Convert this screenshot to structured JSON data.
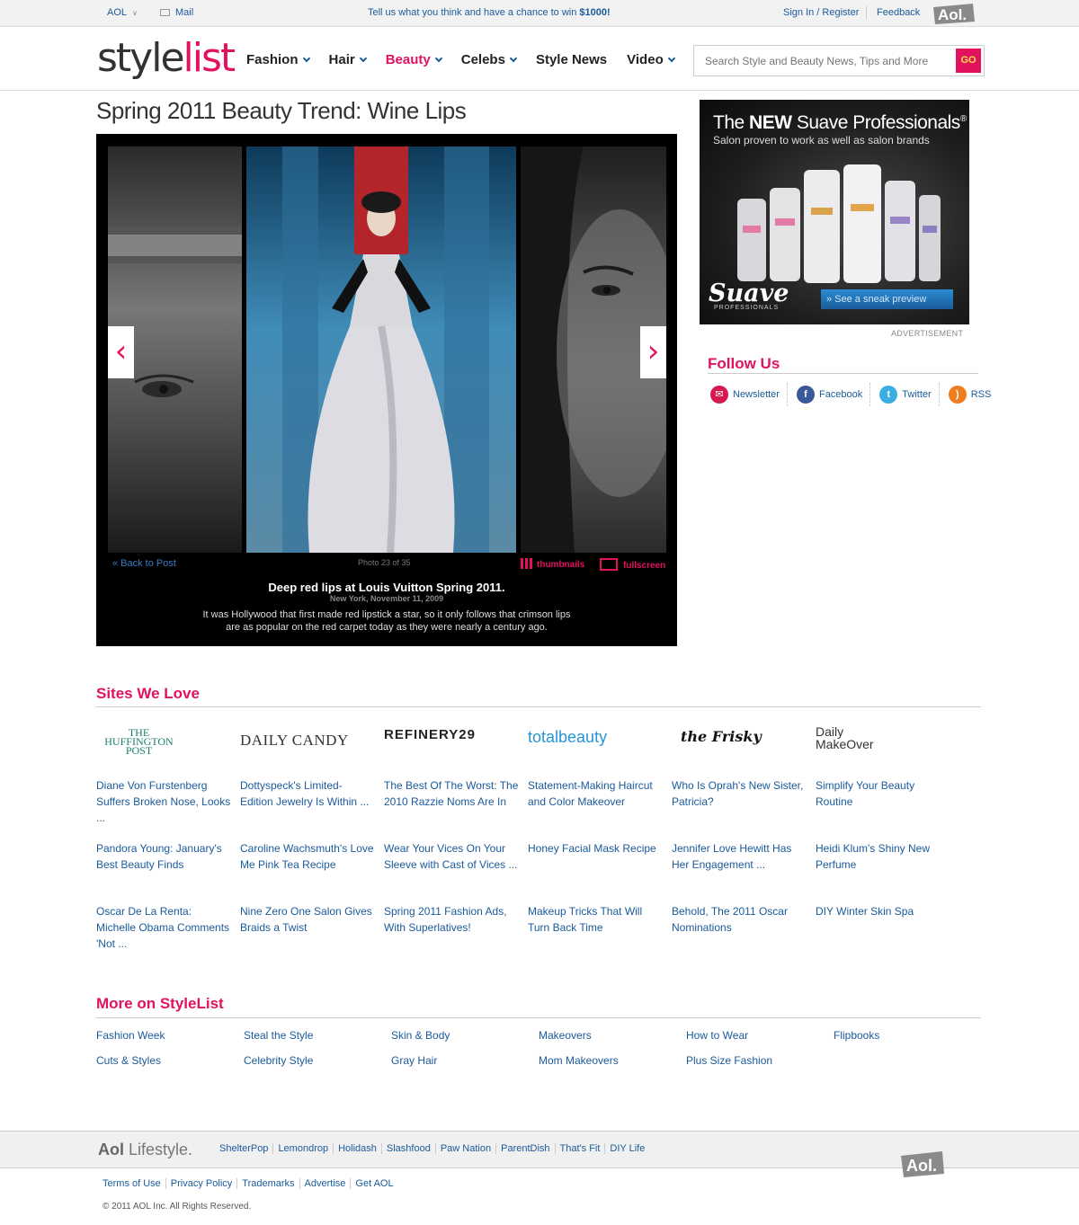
{
  "topbar": {
    "aol_label": "AOL",
    "mail_label": "Mail",
    "promo_text": "Tell us what you think and have a chance to win ",
    "promo_amount": "$1000!",
    "signin_label": "Sign In / Register",
    "feedback_label": "Feedback",
    "aol_logo": "Aol."
  },
  "header": {
    "logo_style": "style",
    "logo_list": "list",
    "nav": [
      {
        "label": "Fashion",
        "has_menu": true
      },
      {
        "label": "Hair",
        "has_menu": true
      },
      {
        "label": "Beauty",
        "has_menu": true,
        "active": true
      },
      {
        "label": "Celebs",
        "has_menu": true
      },
      {
        "label": "Style News",
        "has_menu": false
      },
      {
        "label": "Video",
        "has_menu": true
      }
    ],
    "search_placeholder": "Search Style and Beauty News, Tips and More",
    "go_label": "GO",
    "accent_color": "#e2125f"
  },
  "page_title": "Spring 2011 Beauty Trend: Wine Lips",
  "gallery": {
    "back_label": "« Back to Post",
    "photo_count": "Photo 23 of 35",
    "thumbnails_label": "thumbnails",
    "fullscreen_label": "fullscreen",
    "caption_title": "Deep red lips at Louis Vuitton Spring 2011.",
    "caption_date": "New York, November 11, 2009",
    "caption_text": "It was Hollywood that first made red lipstick a star, so it only follows that crimson lips are as popular on the red carpet today as they were nearly a century ago.",
    "prev_icon": "chevron-left-icon",
    "next_icon": "chevron-right-icon"
  },
  "ad": {
    "headline_pre": "The ",
    "headline_bold": "NEW",
    "headline_post": " Suave Professionals",
    "headline_reg": "®",
    "sub": "Salon proven to work as well as salon brands",
    "brand": "Suave",
    "brand_sub": "PROFESSIONALS",
    "cta": "» See a sneak preview",
    "label": "ADVERTISEMENT"
  },
  "follow": {
    "title": "Follow Us",
    "links": [
      {
        "label": "Newsletter",
        "icon": "mail-icon",
        "color": "#d8194f"
      },
      {
        "label": "Facebook",
        "icon": "facebook-icon",
        "color": "#3b5998"
      },
      {
        "label": "Twitter",
        "icon": "twitter-icon",
        "color": "#3aaee3"
      },
      {
        "label": "RSS",
        "icon": "rss-icon",
        "color": "#f07d1d"
      }
    ]
  },
  "sites_we_love": {
    "title": "Sites We Love",
    "sites": [
      {
        "logo": "THE HUFFINGTON POST",
        "links": [
          "Diane Von Furstenberg Suffers Broken Nose, Looks ...",
          "Pandora Young: January's Best Beauty Finds",
          "Oscar De La Renta: Michelle Obama Comments 'Not ..."
        ]
      },
      {
        "logo": "DAILY CANDY",
        "links": [
          "Dottyspeck's Limited-Edition Jewelry Is Within ...",
          "Caroline Wachsmuth's Love Me Pink Tea Recipe",
          "Nine Zero One Salon Gives Braids a Twist"
        ]
      },
      {
        "logo": "REFINERY29",
        "links": [
          "The Best Of The Worst: The 2010 Razzie Noms Are In",
          "Wear Your Vices On Your Sleeve with Cast of Vices ...",
          "Spring 2011 Fashion Ads, With Superlatives!"
        ]
      },
      {
        "logo": "totalbeauty",
        "links": [
          "Statement-Making Haircut and Color Makeover",
          "Honey Facial Mask Recipe",
          "Makeup Tricks That Will Turn Back Time"
        ]
      },
      {
        "logo": "the Frisky",
        "links": [
          "Who Is Oprah's New Sister, Patricia?",
          "Jennifer Love Hewitt Has Her Engagement ...",
          "Behold, The 2011 Oscar Nominations"
        ]
      },
      {
        "logo": "Daily MakeOver",
        "links": [
          "Simplify Your Beauty Routine",
          "Heidi Klum's Shiny New Perfume",
          "DIY Winter Skin Spa"
        ]
      }
    ]
  },
  "more": {
    "title": "More on StyleList",
    "row1": [
      "Fashion Week",
      "Steal the Style",
      "Skin & Body",
      "Makeovers",
      "How to Wear",
      "Flipbooks"
    ],
    "row2": [
      "Cuts & Styles",
      "Celebrity Style",
      "Gray Hair",
      "Mom Makeovers",
      "Plus Size Fashion"
    ]
  },
  "footer": {
    "lifestyle_brand": "Aol",
    "lifestyle_word": " Lifestyle.",
    "lifestyle_links": [
      "ShelterPop",
      "Lemondrop",
      "Holidash",
      "Slashfood",
      "Paw Nation",
      "ParentDish",
      "That's Fit",
      "DIY Life"
    ],
    "legal_links": [
      "Terms of Use",
      "Privacy Policy",
      "Trademarks",
      "Advertise",
      "Get AOL"
    ],
    "copyright": "© 2011 AOL Inc. All Rights Reserved."
  }
}
